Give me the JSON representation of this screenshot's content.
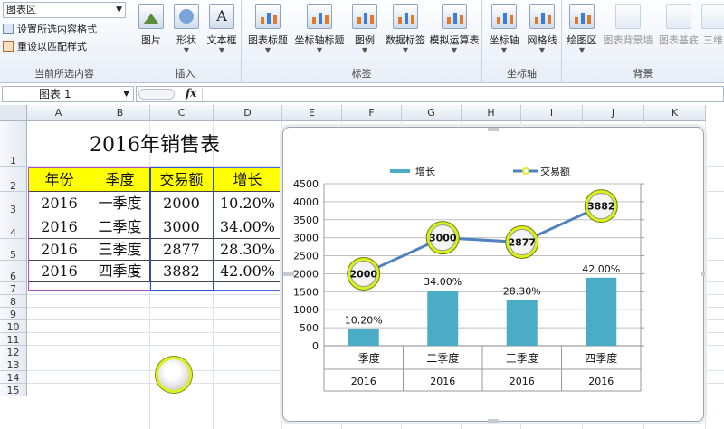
{
  "ribbon": {
    "current_selection": {
      "dropdown_value": "图表区",
      "format_selection": "设置所选内容格式",
      "reset_style": "重设以匹配样式",
      "group_label": "当前所选内容"
    },
    "insert": {
      "picture": "图片",
      "shapes": "形状",
      "textbox": "文本框",
      "group_label": "插入"
    },
    "labels": {
      "chart_title": "图表标题",
      "axis_titles": "坐标轴标题",
      "legend": "图例",
      "data_labels": "数据标签",
      "data_table": "模拟运算表",
      "group_label": "标签"
    },
    "axes": {
      "axes": "坐标轴",
      "gridlines": "网格线",
      "group_label": "坐标轴"
    },
    "background": {
      "plot_area": "绘图区",
      "chart_wall": "图表背景墙",
      "chart_floor": "图表基底",
      "rotation": "三维",
      "group_label": "背景"
    }
  },
  "formula_bar": {
    "name_box": "图表 1",
    "fx": "fx"
  },
  "sheet": {
    "columns": [
      "A",
      "B",
      "C",
      "D",
      "E",
      "F",
      "G",
      "H",
      "I",
      "J",
      "K"
    ],
    "rows": [
      "1",
      "2",
      "3",
      "4",
      "5",
      "6",
      "7",
      "8",
      "9",
      "10",
      "11",
      "12",
      "13",
      "14",
      "15"
    ],
    "title": "2016年销售表",
    "headers": [
      "年份",
      "季度",
      "交易额",
      "增长"
    ],
    "data": [
      [
        "2016",
        "一季度",
        "2000",
        "10.20%"
      ],
      [
        "2016",
        "二季度",
        "3000",
        "34.00%"
      ],
      [
        "2016",
        "三季度",
        "2877",
        "28.30%"
      ],
      [
        "2016",
        "四季度",
        "3882",
        "42.00%"
      ]
    ]
  },
  "chart_data": {
    "type": "bar",
    "categories": [
      "一季度",
      "二季度",
      "三季度",
      "四季度"
    ],
    "category_groups": [
      "2016",
      "2016",
      "2016",
      "2016"
    ],
    "legend_position": "top",
    "grid": true,
    "ylim": [
      0,
      4500
    ],
    "yticks": [
      "0",
      "500",
      "1000",
      "1500",
      "2000",
      "2500",
      "3000",
      "3500",
      "4000",
      "4500"
    ],
    "series": [
      {
        "name": "增长",
        "kind": "bar",
        "values": [
          10.2,
          34.0,
          28.3,
          42.0
        ],
        "labels": [
          "10.20%",
          "34.00%",
          "28.30%",
          "42.00%"
        ],
        "color": "#4bacc6"
      },
      {
        "name": "交易额",
        "kind": "line",
        "values": [
          2000,
          3000,
          2877,
          3882
        ],
        "labels": [
          "2000",
          "3000",
          "2877",
          "3882"
        ],
        "color": "#4f81bd"
      }
    ],
    "bar_axis_max": 100
  },
  "colors": {
    "header_fill": "#ffff00",
    "bar": "#4bacc6",
    "line": "#4f81bd",
    "marker_ring": "#d9ef1e"
  }
}
